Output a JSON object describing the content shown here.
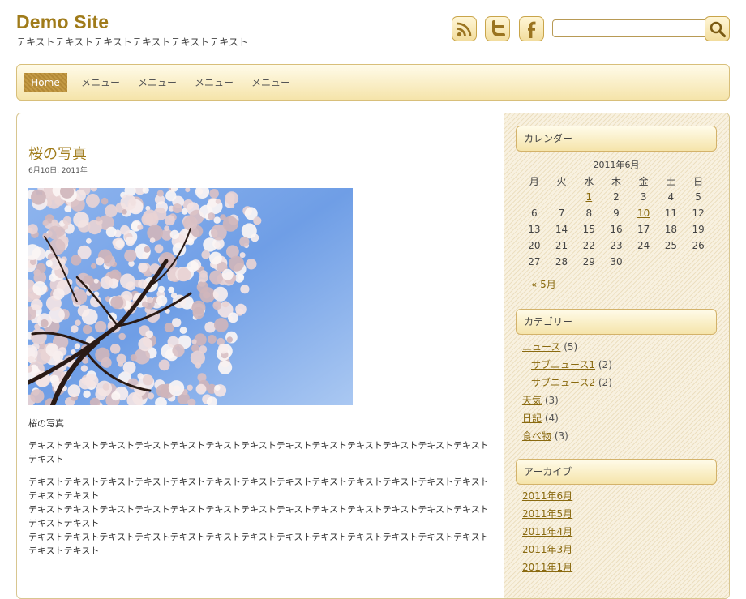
{
  "header": {
    "site_title": "Demo Site",
    "tagline": "テキストテキストテキストテキストテキストテキスト",
    "search_placeholder": ""
  },
  "social": {
    "rss_icon": "rss-icon",
    "twitter_icon": "twitter-icon",
    "facebook_icon": "facebook-icon"
  },
  "nav": {
    "items": [
      "Home",
      "メニュー",
      "メニュー",
      "メニュー",
      "メニュー"
    ]
  },
  "post": {
    "title": "桜の写真",
    "date": "6月10日, 2011年",
    "image": "cherry-blossom-photo",
    "caption": "桜の写真",
    "paragraphs": [
      "テキストテキストテキストテキストテキストテキストテキストテキストテキストテキストテキストテキストテキストテキスト",
      "テキストテキストテキストテキストテキストテキストテキストテキストテキストテキストテキストテキストテキストテキストテキスト\nテキストテキストテキストテキストテキストテキストテキストテキストテキストテキストテキストテキストテキストテキストテキスト\nテキストテキストテキストテキストテキストテキストテキストテキストテキストテキストテキストテキストテキストテキストテキスト"
    ]
  },
  "sidebar": {
    "calendar": {
      "title": "カレンダー",
      "caption": "2011年6月",
      "weekdays": [
        "月",
        "火",
        "水",
        "木",
        "金",
        "土",
        "日"
      ],
      "weeks": [
        [
          "",
          "",
          "1",
          "2",
          "3",
          "4",
          "5"
        ],
        [
          "6",
          "7",
          "8",
          "9",
          "10",
          "11",
          "12"
        ],
        [
          "13",
          "14",
          "15",
          "16",
          "17",
          "18",
          "19"
        ],
        [
          "20",
          "21",
          "22",
          "23",
          "24",
          "25",
          "26"
        ],
        [
          "27",
          "28",
          "29",
          "30",
          "",
          "",
          ""
        ]
      ],
      "linked_days": [
        "1",
        "10"
      ],
      "prev_link": "« 5月"
    },
    "categories": {
      "title": "カテゴリー",
      "items": [
        {
          "label": "ニュース",
          "count": "(5)",
          "sub": false
        },
        {
          "label": "サブニュース1",
          "count": "(2)",
          "sub": true
        },
        {
          "label": "サブニュース2",
          "count": "(2)",
          "sub": true
        },
        {
          "label": "天気",
          "count": "(3)",
          "sub": false
        },
        {
          "label": "日記",
          "count": "(4)",
          "sub": false
        },
        {
          "label": "食べ物",
          "count": "(3)",
          "sub": false
        }
      ]
    },
    "archives": {
      "title": "アーカイブ",
      "items": [
        "2011年6月",
        "2011年5月",
        "2011年4月",
        "2011年3月",
        "2011年1月"
      ]
    }
  },
  "colors": {
    "accent": "#a07b1a",
    "link": "#8a6a10",
    "nav_bg": "#f5e4aa",
    "border": "#d8bf7a"
  }
}
